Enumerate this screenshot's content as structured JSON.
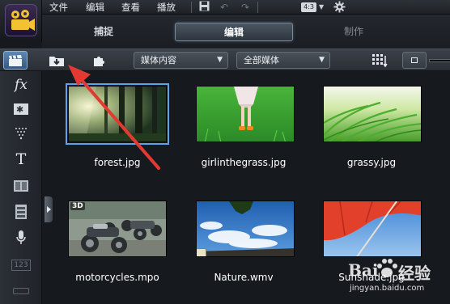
{
  "menu": {
    "items": [
      "文件",
      "编辑",
      "查看",
      "播放"
    ],
    "ratio_label": "4:3"
  },
  "tabs": [
    {
      "label": "捕捉",
      "state": "normal"
    },
    {
      "label": "编辑",
      "state": "active"
    },
    {
      "label": "制作",
      "state": "disabled"
    }
  ],
  "toolbar": {
    "filter_select": "媒体内容",
    "scope_select": "全部媒体"
  },
  "side_tools": [
    {
      "name": "media-icon",
      "glyph": "🎬"
    },
    {
      "name": "filter-fx-icon",
      "glyph": "fx"
    },
    {
      "name": "transition-icon",
      "glyph": "✱"
    },
    {
      "name": "particle-icon",
      "glyph": "⋮"
    },
    {
      "name": "title-icon",
      "glyph": "T"
    },
    {
      "name": "graphics-icon",
      "glyph": "▦"
    },
    {
      "name": "motion-icon",
      "glyph": "▤"
    },
    {
      "name": "audio-icon",
      "glyph": "🎙"
    },
    {
      "name": "counter-icon",
      "glyph": "123"
    },
    {
      "name": "more-icon",
      "glyph": "…"
    }
  ],
  "library": {
    "items": [
      {
        "filename": "forest.jpg",
        "scene": "forest",
        "selected": true
      },
      {
        "filename": "girlinthegrass.jpg",
        "scene": "girl",
        "selected": false
      },
      {
        "filename": "grassy.jpg",
        "scene": "grass",
        "selected": false
      },
      {
        "filename": "motorcycles.mpo",
        "scene": "motor",
        "selected": false,
        "badge": "3D"
      },
      {
        "filename": "Nature.wmv",
        "scene": "sky",
        "selected": false,
        "video": true
      },
      {
        "filename": "Sunshade.jpg",
        "scene": "umbrella",
        "selected": false
      }
    ]
  },
  "watermark": {
    "brand": "Bai",
    "brand_cn": "经验",
    "url": "jingyan.baidu.com"
  },
  "colors": {
    "accent": "#5da3ea",
    "arrow": "#e23a33"
  }
}
